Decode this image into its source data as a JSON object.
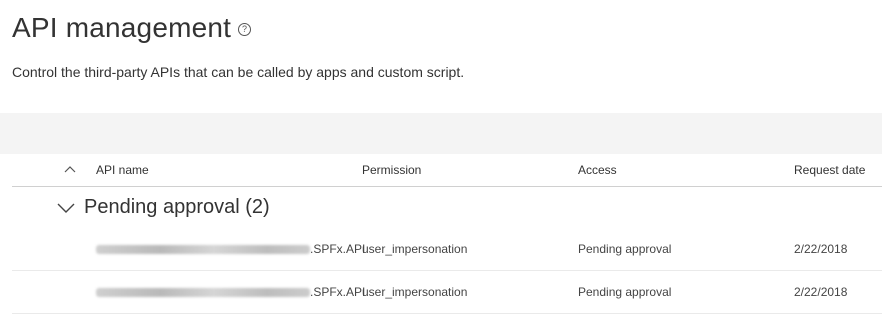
{
  "page": {
    "title": "API management",
    "description": "Control the third-party APIs that can be called by apps and custom script."
  },
  "table": {
    "columns": {
      "api_name": "API name",
      "permission": "Permission",
      "access": "Access",
      "request_date": "Request date"
    },
    "group": {
      "label": "Pending approval (2)"
    },
    "rows": [
      {
        "api_suffix": ".SPFx.API",
        "permission": "user_impersonation",
        "access": "Pending approval",
        "request_date": "2/22/2018"
      },
      {
        "api_suffix": ".SPFx.API",
        "permission": "user_impersonation",
        "access": "Pending approval",
        "request_date": "2/22/2018"
      }
    ]
  },
  "colors": {
    "command_bar": "#f4f4f4",
    "text": "#333333",
    "divider": "#d0d0d0"
  }
}
